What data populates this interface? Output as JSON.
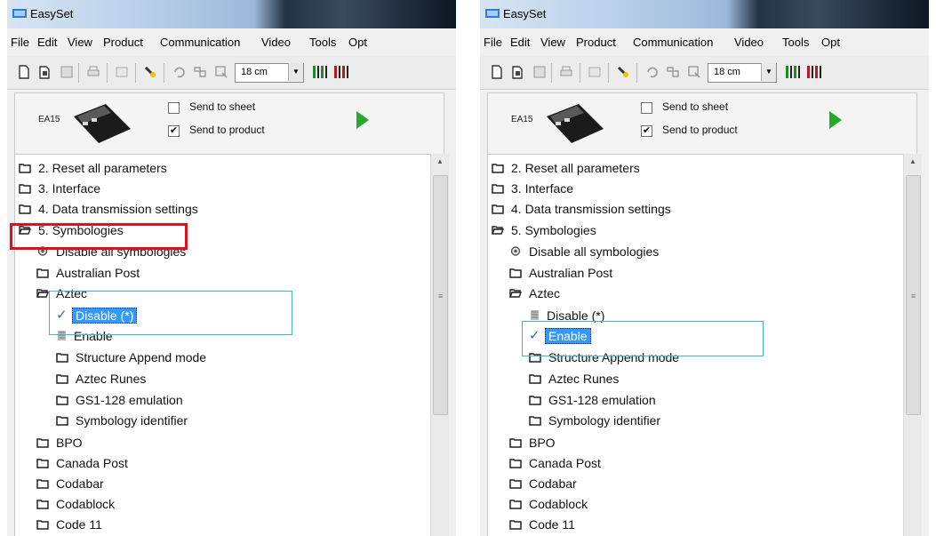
{
  "colors": {
    "selection_bg": "#3399ff",
    "highlight_red": "#e0101a",
    "highlight_cyan": "#3fb6c7",
    "play_green": "#27a82b",
    "folder_stroke": "#222222"
  },
  "panels": [
    {
      "app_title": "EasySet",
      "menu": [
        "File",
        "Edit",
        "View",
        "Product",
        "Communication",
        "Video",
        "Tools",
        "Opt"
      ],
      "toolbar": {
        "icons": [
          "new-file-icon",
          "open-file-icon",
          "save-icon",
          "print-icon",
          "edit-icon",
          "barcode-wand-icon",
          "undo-icon",
          "find-icon",
          "settings-icon"
        ],
        "distance_value": "18 cm",
        "extra_icons": [
          "barcode-green-icon",
          "barcode-red-icon"
        ]
      },
      "device": {
        "model": "EA15",
        "send_to_sheet": {
          "label": "Send to sheet",
          "checked": false
        },
        "send_to_product": {
          "label": "Send to product",
          "checked": true
        }
      },
      "tree": [
        {
          "label": "2. Reset all parameters",
          "icon": "folder-icon"
        },
        {
          "label": "3. Interface",
          "icon": "folder-icon"
        },
        {
          "label": "4. Data transmission settings",
          "icon": "folder-icon"
        },
        {
          "label": "5. Symbologies",
          "icon": "folder-open-icon"
        },
        {
          "label": "Disable all symbologies",
          "icon": "gear-icon"
        },
        {
          "label": "Australian Post",
          "icon": "folder-icon"
        },
        {
          "label": "Aztec",
          "icon": "folder-open-icon"
        },
        {
          "label": "Disable (*)",
          "icon": "check-icon",
          "selected": true
        },
        {
          "label": "Enable",
          "icon": "option-icon"
        },
        {
          "label": "Structure Append mode",
          "icon": "folder-icon"
        },
        {
          "label": "Aztec Runes",
          "icon": "folder-icon"
        },
        {
          "label": "GS1-128 emulation",
          "icon": "folder-icon"
        },
        {
          "label": "Symbology identifier",
          "icon": "folder-icon"
        },
        {
          "label": "BPO",
          "icon": "folder-icon"
        },
        {
          "label": "Canada Post",
          "icon": "folder-icon"
        },
        {
          "label": "Codabar",
          "icon": "folder-icon"
        },
        {
          "label": "Codablock",
          "icon": "folder-icon"
        },
        {
          "label": "Code 11",
          "icon": "folder-icon"
        }
      ]
    },
    {
      "app_title": "EasySet",
      "menu": [
        "File",
        "Edit",
        "View",
        "Product",
        "Communication",
        "Video",
        "Tools",
        "Opt"
      ],
      "toolbar": {
        "icons": [
          "new-file-icon",
          "open-file-icon",
          "save-icon",
          "print-icon",
          "edit-icon",
          "barcode-wand-icon",
          "undo-icon",
          "find-icon",
          "settings-icon"
        ],
        "distance_value": "18 cm",
        "extra_icons": [
          "barcode-green-icon",
          "barcode-red-icon"
        ]
      },
      "device": {
        "model": "EA15",
        "send_to_sheet": {
          "label": "Send to sheet",
          "checked": false
        },
        "send_to_product": {
          "label": "Send to product",
          "checked": true
        }
      },
      "tree": [
        {
          "label": "2. Reset all parameters",
          "icon": "folder-icon"
        },
        {
          "label": "3. Interface",
          "icon": "folder-icon"
        },
        {
          "label": "4. Data transmission settings",
          "icon": "folder-icon"
        },
        {
          "label": "5. Symbologies",
          "icon": "folder-open-icon"
        },
        {
          "label": "Disable all symbologies",
          "icon": "gear-icon"
        },
        {
          "label": "Australian Post",
          "icon": "folder-icon"
        },
        {
          "label": "Aztec",
          "icon": "folder-open-icon"
        },
        {
          "label": "Disable (*)",
          "icon": "option-icon"
        },
        {
          "label": "Enable",
          "icon": "check-icon",
          "selected": true
        },
        {
          "label": "Structure Append mode",
          "icon": "folder-icon"
        },
        {
          "label": "Aztec Runes",
          "icon": "folder-icon"
        },
        {
          "label": "GS1-128 emulation",
          "icon": "folder-icon"
        },
        {
          "label": "Symbology identifier",
          "icon": "folder-icon"
        },
        {
          "label": "BPO",
          "icon": "folder-icon"
        },
        {
          "label": "Canada Post",
          "icon": "folder-icon"
        },
        {
          "label": "Codabar",
          "icon": "folder-icon"
        },
        {
          "label": "Codablock",
          "icon": "folder-icon"
        },
        {
          "label": "Code 11",
          "icon": "folder-icon"
        }
      ]
    }
  ]
}
